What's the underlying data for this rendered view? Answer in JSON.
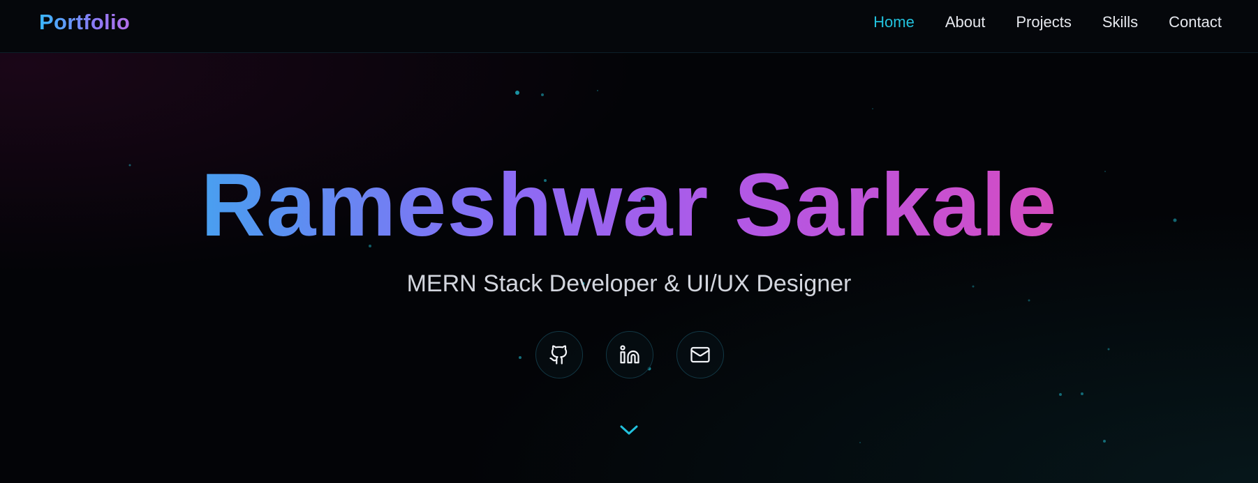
{
  "nav": {
    "brand": "Portfolio",
    "links": [
      {
        "label": "Home",
        "active": true
      },
      {
        "label": "About",
        "active": false
      },
      {
        "label": "Projects",
        "active": false
      },
      {
        "label": "Skills",
        "active": false
      },
      {
        "label": "Contact",
        "active": false
      }
    ]
  },
  "hero": {
    "name": "Rameshwar Sarkale",
    "subtitle": "MERN Stack Developer & UI/UX Designer",
    "social": [
      {
        "icon": "github-icon"
      },
      {
        "icon": "linkedin-icon"
      },
      {
        "icon": "mail-icon"
      }
    ],
    "scroll_icon": "chevron-down-icon"
  },
  "colors": {
    "background": "#030407",
    "accent": "#22c1dd",
    "gradient_start": "#1fd0ee",
    "gradient_mid": "#a855f7",
    "gradient_end": "#ec4899"
  }
}
